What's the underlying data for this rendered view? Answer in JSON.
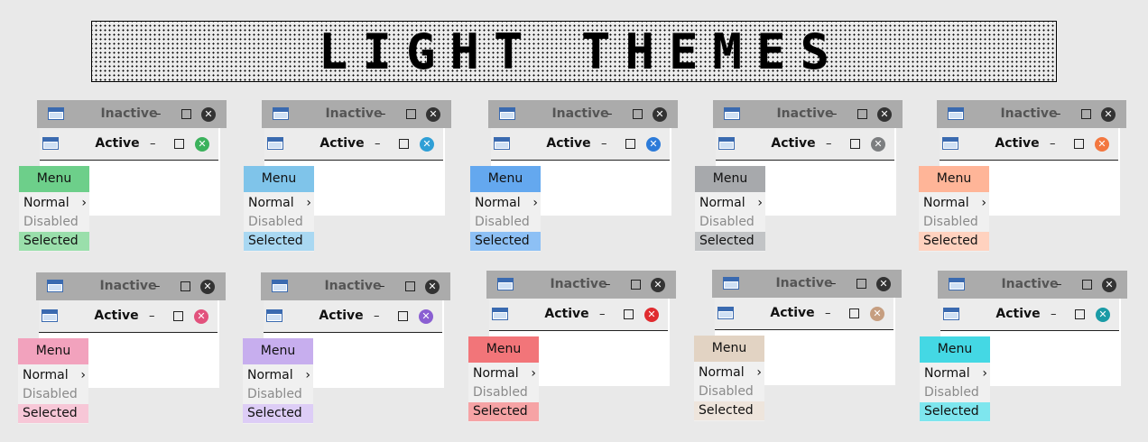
{
  "banner": {
    "title": "LIGHT THEMES"
  },
  "labels": {
    "inactive": "Inactive",
    "active": "Active",
    "menu": "Menu",
    "normal": "Normal",
    "disabled": "Disabled",
    "selected": "Selected",
    "minimize": "–",
    "close": "✕",
    "submenu_arrow": "›"
  },
  "icons": {
    "window": "window-app-icon",
    "minimize": "minimize-icon",
    "maximize": "maximize-icon",
    "close": "close-circle-icon",
    "submenu": "chevron-right-icon"
  },
  "themes": [
    {
      "id": "green",
      "accent": "#6dcf8a",
      "selected": "#9adfab",
      "close": "#3bb25c"
    },
    {
      "id": "light-blue",
      "accent": "#7fc4ea",
      "selected": "#a9d8f2",
      "close": "#2f9fd6"
    },
    {
      "id": "blue",
      "accent": "#64a8ef",
      "selected": "#8dc0f5",
      "close": "#2c7bd9"
    },
    {
      "id": "gray",
      "accent": "#a7a9ac",
      "selected": "#c2c4c6",
      "close": "#7c7e80"
    },
    {
      "id": "orange",
      "accent": "#ffb598",
      "selected": "#ffd2bf",
      "close": "#f3773f"
    },
    {
      "id": "pink",
      "accent": "#f2a2bd",
      "selected": "#f7c7d7",
      "close": "#e2527d"
    },
    {
      "id": "purple",
      "accent": "#c7aeee",
      "selected": "#ddcdf6",
      "close": "#8a5fd2"
    },
    {
      "id": "red",
      "accent": "#f27579",
      "selected": "#f6a3a5",
      "close": "#e02b2f"
    },
    {
      "id": "beige",
      "accent": "#e2d3c3",
      "selected": "#eee5dc",
      "close": "#c69e80"
    },
    {
      "id": "cyan",
      "accent": "#44d8e4",
      "selected": "#7ee6ee",
      "close": "#1a9ba6"
    }
  ]
}
